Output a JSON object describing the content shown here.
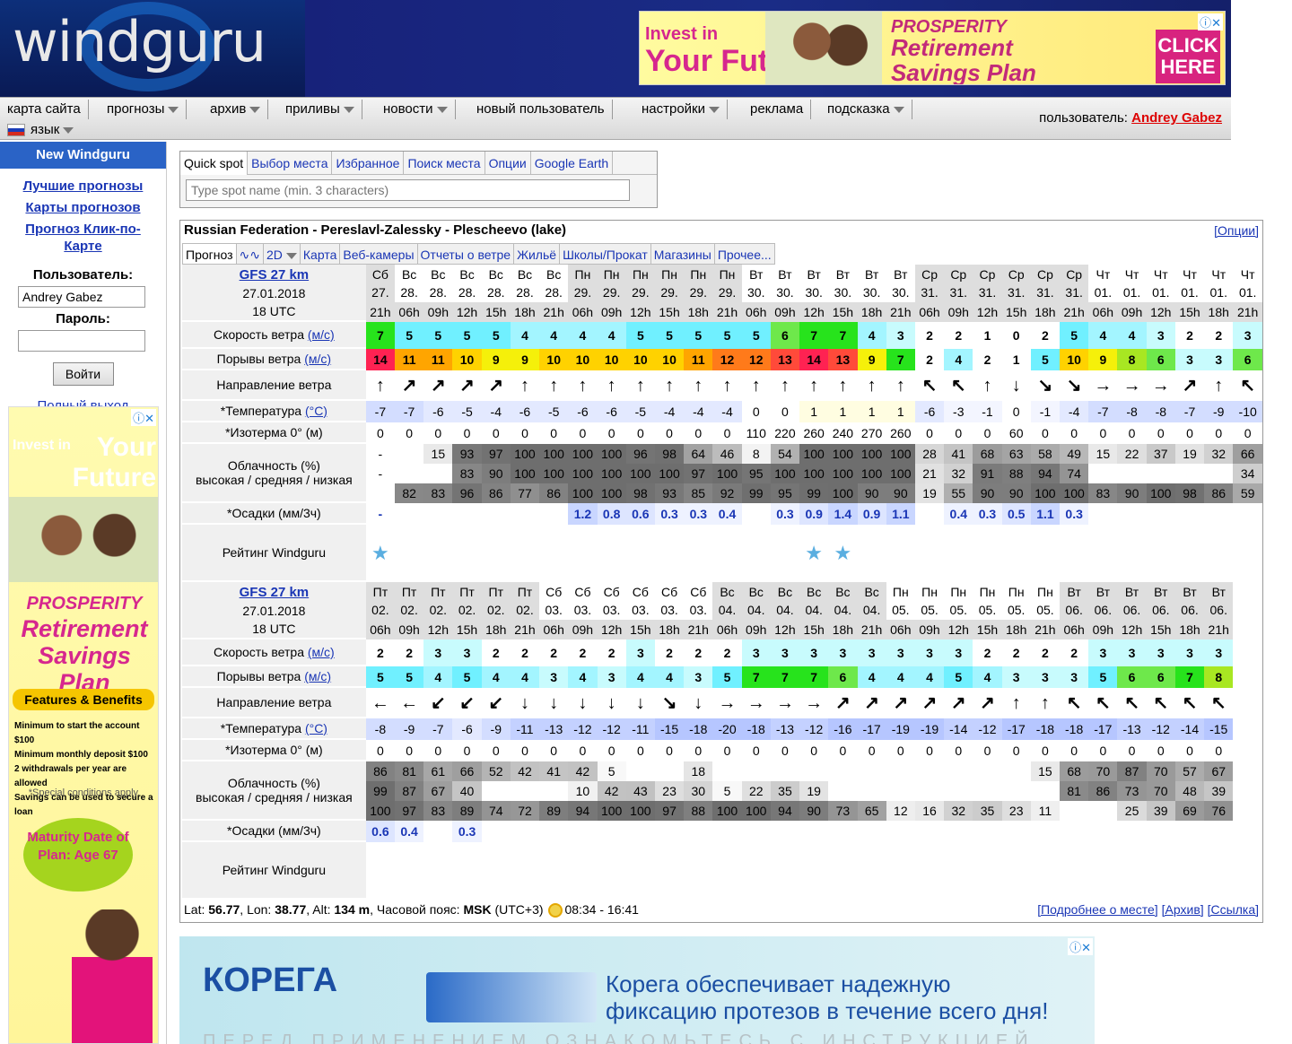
{
  "header": {
    "logo": "windguru",
    "ad": {
      "invest": "Invest in",
      "your_future": "Your Future",
      "prosperity": "PROSPERITY",
      "plan": "Retirement Savings Plan",
      "click": "CLICK HERE"
    }
  },
  "menu": {
    "items": [
      "карта сайта",
      "прогнозы",
      "архив",
      "приливы",
      "новости",
      "новый пользователь",
      "настройки",
      "реклама",
      "подсказка"
    ],
    "lang": "язык",
    "user_label": "пользователь:",
    "user_name": "Andrey Gabez"
  },
  "sidebar": {
    "title": "New Windguru",
    "links": [
      "Лучшие прогнозы",
      "Карты прогнозов",
      "Прогноз Клик-по-Карте"
    ],
    "user_label": "Пользователь:",
    "user_value": "Andrey Gabez",
    "pass_label": "Пароль:",
    "login": "Войти",
    "logout": "Полный выход",
    "ad": {
      "invest": "Invest in",
      "your_future": "Your Future",
      "prosperity": "PROSPERITY",
      "plan": "Retirement Savings Plan",
      "features": "Features & Benefits",
      "bullets": [
        "Minimum to start the account $100",
        "Minimum monthly deposit $100",
        "2 withdrawals per year are allowed",
        "Savings can be used to secure a loan"
      ],
      "special": "*Special conditions apply.",
      "maturity": "Maturity Date of Plan: Age 67"
    }
  },
  "quickspot": {
    "tabs": [
      "Quick spot",
      "Выбор места",
      "Избранное",
      "Поиск места",
      "Опции",
      "Google Earth"
    ],
    "placeholder": "Type spot name (min. 3 characters)"
  },
  "forecast": {
    "title": "Russian Federation - Pereslavl-Zalessky - Plescheevo (lake)",
    "options": "[Опции]",
    "tabs": [
      "Прогноз",
      "2D",
      "Карта",
      "Веб-камеры",
      "Отчеты о ветре",
      "Жильё",
      "Школы/Прокат",
      "Магазины",
      "Прочее..."
    ],
    "model": "GFS 27 km",
    "run_date": "27.01.2018",
    "run_time": "18 UTC",
    "labels": {
      "speed": "Скорость ветра",
      "speed_unit": "(м/с)",
      "gust": "Порывы ветра",
      "dir": "Направление ветра",
      "temp": "*Температура",
      "temp_unit": "(°C)",
      "iso": "*Изотерма 0° (м)",
      "cloud1": "Облачность (%)",
      "cloud2": "высокая / средняя / низкая",
      "prec": "*Осадки (мм/3ч)",
      "rating": "Рейтинг Windguru"
    },
    "footer": {
      "lat_label": "Lat:",
      "lat": "56.77",
      "lon_label": "Lon:",
      "lon": "38.77",
      "alt_label": "Alt:",
      "alt": "134 m",
      "tz_label": "Часовой пояс:",
      "tz": "MSK",
      "tz_off": "(UTC+3)",
      "sun": "08:34 - 16:41",
      "links": [
        "[Подробнее о месте]",
        "[Архив]",
        "[Ссылка]"
      ]
    },
    "blocks": [
      {
        "days": [
          "Сб",
          "Вс",
          "Вс",
          "Вс",
          "Вс",
          "Вс",
          "Вс",
          "Пн",
          "Пн",
          "Пн",
          "Пн",
          "Пн",
          "Пн",
          "Вт",
          "Вт",
          "Вт",
          "Вт",
          "Вт",
          "Вт",
          "Ср",
          "Ср",
          "Ср",
          "Ср",
          "Ср",
          "Ср",
          "Чт",
          "Чт",
          "Чт",
          "Чт",
          "Чт",
          "Чт"
        ],
        "dates": [
          "27.",
          "28.",
          "28.",
          "28.",
          "28.",
          "28.",
          "28.",
          "29.",
          "29.",
          "29.",
          "29.",
          "29.",
          "29.",
          "30.",
          "30.",
          "30.",
          "30.",
          "30.",
          "30.",
          "31.",
          "31.",
          "31.",
          "31.",
          "31.",
          "31.",
          "01.",
          "01.",
          "01.",
          "01.",
          "01.",
          "01."
        ],
        "hours": [
          "21h",
          "06h",
          "09h",
          "12h",
          "15h",
          "18h",
          "21h",
          "06h",
          "09h",
          "12h",
          "15h",
          "18h",
          "21h",
          "06h",
          "09h",
          "12h",
          "15h",
          "18h",
          "21h",
          "06h",
          "09h",
          "12h",
          "15h",
          "18h",
          "21h",
          "06h",
          "09h",
          "12h",
          "15h",
          "18h",
          "21h"
        ],
        "speed": [
          "7",
          "5",
          "5",
          "5",
          "5",
          "4",
          "4",
          "4",
          "4",
          "5",
          "5",
          "5",
          "5",
          "5",
          "6",
          "7",
          "7",
          "4",
          "3",
          "2",
          "2",
          "1",
          "0",
          "2",
          "5",
          "4",
          "4",
          "3",
          "2",
          "2",
          "3"
        ],
        "gust": [
          "14",
          "11",
          "11",
          "10",
          "9",
          "9",
          "10",
          "10",
          "10",
          "10",
          "10",
          "11",
          "12",
          "12",
          "13",
          "14",
          "13",
          "9",
          "7",
          "2",
          "4",
          "2",
          "1",
          "5",
          "10",
          "9",
          "8",
          "6",
          "3",
          "3",
          "6"
        ],
        "dir": [
          "↑",
          "↗",
          "↗",
          "↗",
          "↗",
          "↑",
          "↑",
          "↑",
          "↑",
          "↑",
          "↑",
          "↑",
          "↑",
          "↑",
          "↑",
          "↑",
          "↑",
          "↑",
          "↑",
          "↖",
          "↖",
          "↑",
          "↓",
          "↘",
          "↘",
          "→",
          "→",
          "→",
          "↗",
          "↑",
          "↖"
        ],
        "temp": [
          "-7",
          "-7",
          "-6",
          "-5",
          "-4",
          "-6",
          "-5",
          "-6",
          "-6",
          "-5",
          "-4",
          "-4",
          "-4",
          "0",
          "0",
          "1",
          "1",
          "1",
          "1",
          "-6",
          "-3",
          "-1",
          "0",
          "-1",
          "-4",
          "-7",
          "-8",
          "-8",
          "-7",
          "-9",
          "-10"
        ],
        "iso": [
          "0",
          "0",
          "0",
          "0",
          "0",
          "0",
          "0",
          "0",
          "0",
          "0",
          "0",
          "0",
          "0",
          "110",
          "220",
          "260",
          "240",
          "270",
          "260",
          "0",
          "0",
          "0",
          "60",
          "0",
          "0",
          "0",
          "0",
          "0",
          "0",
          "0",
          "0"
        ],
        "cloud_high": [
          "-",
          "",
          "15",
          "93",
          "97",
          "100",
          "100",
          "100",
          "100",
          "96",
          "98",
          "64",
          "46",
          "8",
          "54",
          "100",
          "100",
          "100",
          "100",
          "28",
          "41",
          "68",
          "63",
          "58",
          "49",
          "15",
          "22",
          "37",
          "19",
          "32",
          "66"
        ],
        "cloud_mid": [
          "-",
          "",
          "",
          "83",
          "90",
          "100",
          "100",
          "100",
          "100",
          "100",
          "100",
          "97",
          "100",
          "95",
          "100",
          "100",
          "100",
          "100",
          "100",
          "21",
          "32",
          "91",
          "88",
          "94",
          "74",
          "",
          "",
          "",
          "",
          "",
          "34"
        ],
        "cloud_low": [
          "",
          "82",
          "83",
          "96",
          "86",
          "77",
          "86",
          "100",
          "100",
          "98",
          "93",
          "85",
          "92",
          "99",
          "95",
          "99",
          "100",
          "90",
          "90",
          "19",
          "55",
          "90",
          "90",
          "100",
          "100",
          "83",
          "90",
          "100",
          "98",
          "86",
          "59"
        ],
        "prec": [
          "-",
          "",
          "",
          "",
          "",
          "",
          "",
          "1.2",
          "0.8",
          "0.6",
          "0.3",
          "0.3",
          "0.4",
          "",
          "0.3",
          "0.9",
          "1.4",
          "0.9",
          "1.1",
          "",
          "0.4",
          "0.3",
          "0.5",
          "1.1",
          "0.3",
          "",
          "",
          "",
          "",
          "",
          ""
        ],
        "rating": [
          "★",
          "",
          "",
          "",
          "",
          "",
          "",
          "",
          "",
          "",
          "",
          "",
          "",
          "",
          "",
          "★",
          "★",
          "",
          "",
          "",
          "",
          "",
          "",
          "",
          "",
          "",
          "",
          "",
          "",
          "",
          ""
        ]
      },
      {
        "days": [
          "Пт",
          "Пт",
          "Пт",
          "Пт",
          "Пт",
          "Пт",
          "Сб",
          "Сб",
          "Сб",
          "Сб",
          "Сб",
          "Сб",
          "Вс",
          "Вс",
          "Вс",
          "Вс",
          "Вс",
          "Вс",
          "Пн",
          "Пн",
          "Пн",
          "Пн",
          "Пн",
          "Пн",
          "Вт",
          "Вт",
          "Вт",
          "Вт",
          "Вт",
          "Вт"
        ],
        "dates": [
          "02.",
          "02.",
          "02.",
          "02.",
          "02.",
          "02.",
          "03.",
          "03.",
          "03.",
          "03.",
          "03.",
          "03.",
          "04.",
          "04.",
          "04.",
          "04.",
          "04.",
          "04.",
          "05.",
          "05.",
          "05.",
          "05.",
          "05.",
          "05.",
          "06.",
          "06.",
          "06.",
          "06.",
          "06.",
          "06."
        ],
        "hours": [
          "06h",
          "09h",
          "12h",
          "15h",
          "18h",
          "21h",
          "06h",
          "09h",
          "12h",
          "15h",
          "18h",
          "21h",
          "06h",
          "09h",
          "12h",
          "15h",
          "18h",
          "21h",
          "06h",
          "09h",
          "12h",
          "15h",
          "18h",
          "21h",
          "06h",
          "09h",
          "12h",
          "15h",
          "18h",
          "21h"
        ],
        "speed": [
          "2",
          "2",
          "3",
          "3",
          "2",
          "2",
          "2",
          "2",
          "2",
          "3",
          "2",
          "2",
          "2",
          "3",
          "3",
          "3",
          "3",
          "3",
          "3",
          "3",
          "3",
          "2",
          "2",
          "2",
          "2",
          "3",
          "3",
          "3",
          "3",
          "3"
        ],
        "gust": [
          "5",
          "5",
          "4",
          "5",
          "4",
          "4",
          "3",
          "4",
          "3",
          "4",
          "4",
          "3",
          "5",
          "7",
          "7",
          "7",
          "6",
          "4",
          "4",
          "4",
          "5",
          "4",
          "3",
          "3",
          "3",
          "5",
          "6",
          "6",
          "7",
          "8"
        ],
        "dir": [
          "←",
          "←",
          "↙",
          "↙",
          "↙",
          "↓",
          "↓",
          "↓",
          "↓",
          "↓",
          "↘",
          "↓",
          "→",
          "→",
          "→",
          "→",
          "↗",
          "↗",
          "↗",
          "↗",
          "↗",
          "↗",
          "↑",
          "↑",
          "↖",
          "↖",
          "↖",
          "↖",
          "↖",
          "↖"
        ],
        "temp": [
          "-8",
          "-9",
          "-7",
          "-6",
          "-9",
          "-11",
          "-13",
          "-12",
          "-12",
          "-11",
          "-15",
          "-18",
          "-20",
          "-18",
          "-13",
          "-12",
          "-16",
          "-17",
          "-19",
          "-19",
          "-14",
          "-12",
          "-17",
          "-18",
          "-18",
          "-17",
          "-13",
          "-12",
          "-14",
          "-15"
        ],
        "iso": [
          "0",
          "0",
          "0",
          "0",
          "0",
          "0",
          "0",
          "0",
          "0",
          "0",
          "0",
          "0",
          "0",
          "0",
          "0",
          "0",
          "0",
          "0",
          "0",
          "0",
          "0",
          "0",
          "0",
          "0",
          "0",
          "0",
          "0",
          "0",
          "0",
          "0"
        ],
        "cloud_high": [
          "86",
          "81",
          "61",
          "66",
          "52",
          "42",
          "41",
          "42",
          "5",
          "",
          "",
          "18",
          "",
          "",
          "",
          "",
          "",
          "",
          "",
          "",
          "",
          "",
          "",
          "15",
          "68",
          "70",
          "87",
          "70",
          "57",
          "67"
        ],
        "cloud_mid": [
          "99",
          "87",
          "67",
          "40",
          "",
          "",
          "",
          "10",
          "42",
          "43",
          "23",
          "30",
          "5",
          "22",
          "35",
          "19",
          "",
          "",
          "",
          "",
          "",
          "",
          "",
          "",
          "81",
          "86",
          "73",
          "70",
          "48",
          "39"
        ],
        "cloud_low": [
          "100",
          "97",
          "83",
          "89",
          "74",
          "72",
          "89",
          "94",
          "100",
          "100",
          "97",
          "88",
          "100",
          "100",
          "94",
          "90",
          "73",
          "65",
          "12",
          "16",
          "32",
          "35",
          "23",
          "11",
          "",
          "",
          "25",
          "39",
          "69",
          "76"
        ],
        "prec": [
          "0.6",
          "0.4",
          "",
          "0.3",
          "",
          "",
          "",
          "",
          "",
          "",
          "",
          "",
          "",
          "",
          "",
          "",
          "",
          "",
          "",
          "",
          "",
          "",
          "",
          "",
          "",
          "",
          "",
          "",
          "",
          ""
        ],
        "rating": [
          "",
          "",
          "",
          "",
          "",
          "",
          "",
          "",
          "",
          "",
          "",
          "",
          "",
          "",
          "",
          "",
          "",
          "",
          "",
          "",
          "",
          "",
          "",
          "",
          "",
          "",
          "",
          "",
          "",
          ""
        ]
      }
    ]
  },
  "ad_bottom": {
    "brand": "КОРЕГА",
    "message1": "Корега обеспечивает надежную",
    "message2": "фиксацию протезов в течение всего дня!",
    "fine": "ПЕРЕД ПРИМЕНЕНИЕМ ОЗНАКОМЬТЕСЬ С ИНСТРУКЦИЕЙ"
  }
}
